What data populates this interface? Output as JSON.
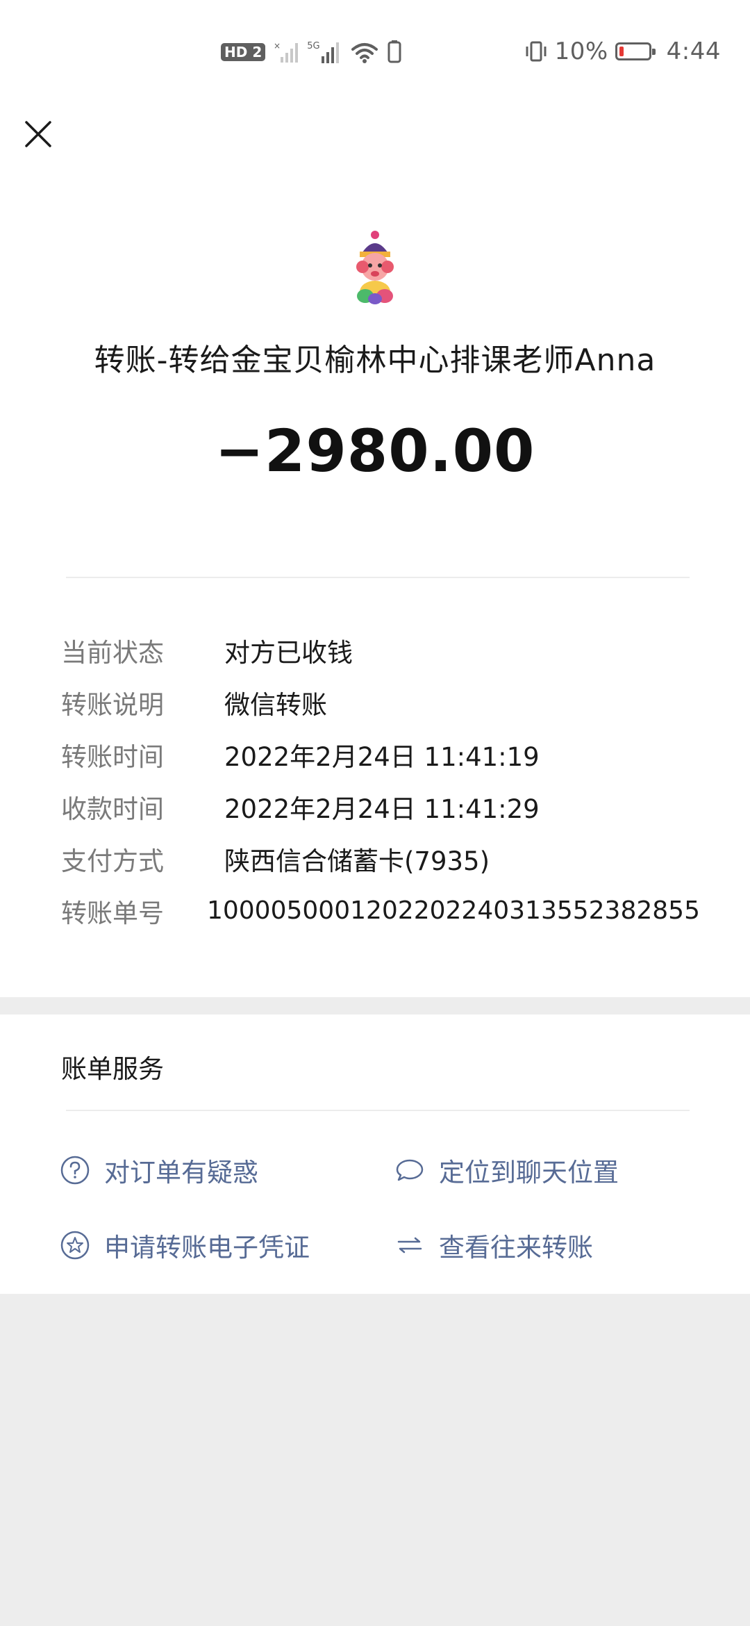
{
  "status_bar": {
    "hd_label": "HD",
    "sim_label": "2",
    "network_label": "5G",
    "battery_percent_text": "10%",
    "battery_level": 0.1,
    "time": "4:44",
    "icons": [
      "hd-icon",
      "signal-x-icon",
      "signal-5g-icon",
      "wifi-icon",
      "phone-icon",
      "vibrate-icon",
      "battery-icon"
    ]
  },
  "header": {
    "close_icon": "close-icon",
    "avatar_icon": "avatar-image"
  },
  "transfer": {
    "title": "转账-转给金宝贝榆林中心排课老师Anna",
    "amount": "−2980.00"
  },
  "details": [
    {
      "label": "当前状态",
      "value": "对方已收钱"
    },
    {
      "label": "转账说明",
      "value": "微信转账"
    },
    {
      "label": "转账时间",
      "value": "2022年2月24日 11:41:19"
    },
    {
      "label": "收款时间",
      "value": "2022年2月24日 11:41:29"
    },
    {
      "label": "支付方式",
      "value": "陕西信合储蓄卡(7935)"
    },
    {
      "label": "转账单号",
      "value": "1000050001202202240313552382855"
    }
  ],
  "services": {
    "title": "账单服务",
    "items": [
      {
        "label": "对订单有疑惑",
        "icon": "question-circle-icon"
      },
      {
        "label": "定位到聊天位置",
        "icon": "chat-bubble-icon"
      },
      {
        "label": "申请转账电子凭证",
        "icon": "star-circle-icon"
      },
      {
        "label": "查看往来转账",
        "icon": "exchange-arrows-icon"
      }
    ]
  },
  "colors": {
    "link": "#576b95",
    "label_gray": "#7a7a7a",
    "background": "#ededed",
    "battery_low": "#e53935"
  }
}
